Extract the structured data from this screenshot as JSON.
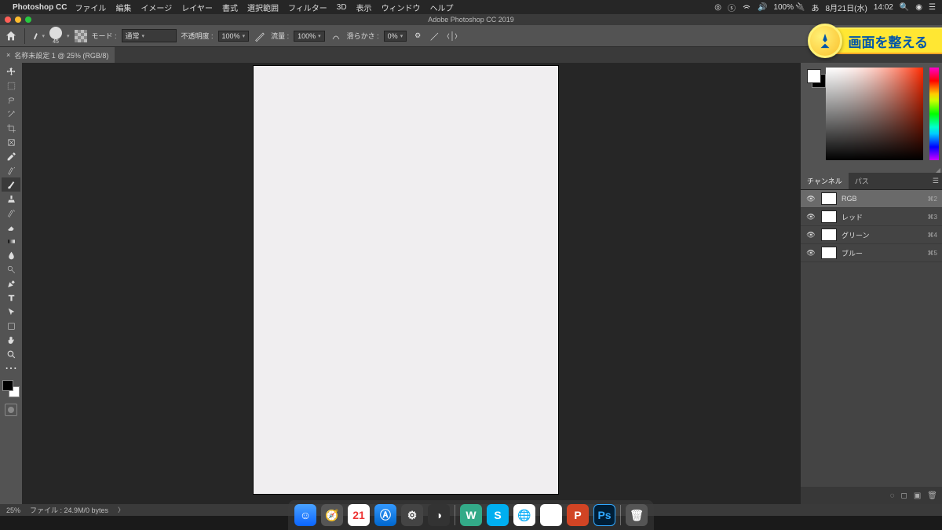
{
  "menubar": {
    "app_name": "Photoshop CC",
    "items": [
      "ファイル",
      "編集",
      "イメージ",
      "レイヤー",
      "書式",
      "選択範囲",
      "フィルター",
      "3D",
      "表示",
      "ウィンドウ",
      "ヘルプ"
    ],
    "status": {
      "battery": "100%",
      "date": "8月21日(水)",
      "time": "14:02"
    }
  },
  "window_title": "Adobe Photoshop CC 2019",
  "options_bar": {
    "brush_size": "45",
    "mode_label": "モード :",
    "mode_value": "通常",
    "opacity_label": "不透明度 :",
    "opacity_value": "100%",
    "flow_label": "流量 :",
    "flow_value": "100%",
    "smooth_label": "滑らかさ :",
    "smooth_value": "0%"
  },
  "doc_tab": "名称未設定 1 @ 25% (RGB/8)",
  "tools": [
    "move",
    "marquee",
    "lasso",
    "wand",
    "crop",
    "frame",
    "eyedropper",
    "heal",
    "brush",
    "clone",
    "history",
    "eraser",
    "gradient",
    "blur",
    "dodge",
    "pen",
    "type",
    "path",
    "shape",
    "hand",
    "zoom",
    "more"
  ],
  "panels": {
    "tabs": {
      "channel": "チャンネル",
      "path": "パス"
    },
    "channels": [
      {
        "name": "RGB",
        "key": "⌘2"
      },
      {
        "name": "レッド",
        "key": "⌘3"
      },
      {
        "name": "グリーン",
        "key": "⌘4"
      },
      {
        "name": "ブルー",
        "key": "⌘5"
      }
    ]
  },
  "status_bar": {
    "zoom": "25%",
    "doc": "ファイル : 24.9M/0 bytes"
  },
  "badge_text": "画面を整える"
}
